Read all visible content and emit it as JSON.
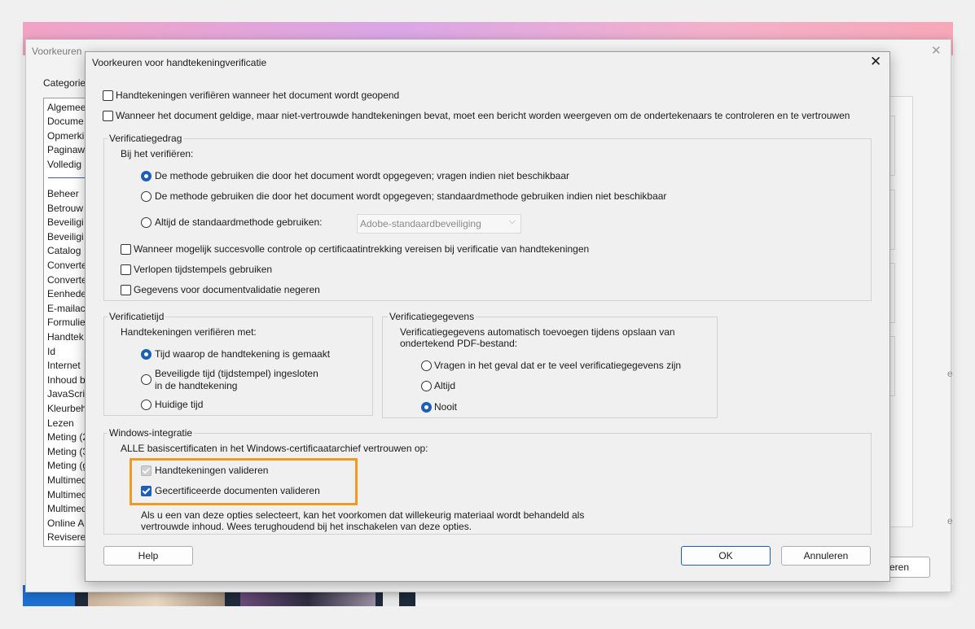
{
  "background_window": {
    "title": "Voorkeuren",
    "categories_label": "Categorie",
    "categories_top": [
      "Algemee",
      "Docume",
      "Opmerki",
      "Paginaw",
      "Volledig"
    ],
    "categories": [
      "Beheer",
      "Betrouw",
      "Beveiligi",
      "Beveiligi",
      "Catalog",
      "Converte",
      "Converte",
      "Eenhede",
      "E-mailac",
      "Formulie",
      "Handtek",
      "Id",
      "Internet",
      "Inhoud b",
      "JavaScri",
      "Kleurbeh",
      "Lezen",
      "Meting (2",
      "Meting (3",
      "Meting (g",
      "Multimed",
      "Multimec",
      "Multimed",
      "Online A",
      "Reviseren"
    ],
    "button_label_partial": "eren",
    "edge_letter": "e"
  },
  "dialog": {
    "title": "Voorkeuren voor handtekeningverificatie",
    "top_options": [
      {
        "label": "Handtekeningen verifiëren wanneer het document wordt geopend",
        "checked": false
      },
      {
        "label": "Wanneer het document geldige, maar niet-vertrouwde handtekeningen bevat, moet een bericht worden weergeven om de ondertekenaars te controleren en te vertrouwen",
        "checked": false
      }
    ],
    "verification_behavior": {
      "legend": "Verificatiegedrag",
      "subtitle": "Bij het verifiëren:",
      "radios": [
        {
          "label": "De methode gebruiken die door het document wordt opgegeven; vragen indien niet beschikbaar",
          "checked": true
        },
        {
          "label": "De methode gebruiken die door het document wordt opgegeven; standaardmethode gebruiken indien niet beschikbaar",
          "checked": false
        },
        {
          "label": "Altijd de standaardmethode gebruiken:",
          "checked": false
        }
      ],
      "dropdown_value": "Adobe-standaardbeveiliging",
      "checkboxes": [
        {
          "label": "Wanneer mogelijk succesvolle controle op certificaatintrekking vereisen bij verificatie van handtekeningen",
          "checked": false
        },
        {
          "label": "Verlopen tijdstempels gebruiken",
          "checked": false
        },
        {
          "label": "Gegevens voor documentvalidatie negeren",
          "checked": false
        }
      ]
    },
    "verification_time": {
      "legend": "Verificatietijd",
      "subtitle": "Handtekeningen verifiëren met:",
      "radios": [
        {
          "label": "Tijd waarop de handtekening is gemaakt",
          "checked": true
        },
        {
          "label_line1": "Beveiligde tijd (tijdstempel) ingesloten",
          "label_line2": "in de handtekening",
          "checked": false
        },
        {
          "label": "Huidige tijd",
          "checked": false
        }
      ]
    },
    "verification_data": {
      "legend": "Verificatiegegevens",
      "subtitle_line1": "Verificatiegegevens automatisch toevoegen tijdens opslaan van",
      "subtitle_line2": "ondertekend PDF-bestand:",
      "radios": [
        {
          "label": "Vragen in het geval dat er te veel verificatiegegevens zijn",
          "checked": false
        },
        {
          "label": "Altijd",
          "checked": false
        },
        {
          "label": "Nooit",
          "checked": true
        }
      ]
    },
    "windows_integration": {
      "legend": "Windows-integratie",
      "subtitle": "ALLE basiscertificaten in het Windows-certificaatarchief vertrouwen op:",
      "checkboxes": [
        {
          "label": "Handtekeningen valideren",
          "checked": true,
          "disabled": true
        },
        {
          "label": "Gecertificeerde documenten valideren",
          "checked": true,
          "disabled": false
        }
      ],
      "note_line1": "Als u een van deze opties selecteert, kan het voorkomen dat willekeurig materiaal wordt behandeld als",
      "note_line2": "vertrouwde inhoud. Wees terughoudend bij het inschakelen van deze opties."
    },
    "buttons": {
      "help": "Help",
      "ok": "OK",
      "cancel": "Annuleren"
    }
  },
  "colors": {
    "accent": "#1c5fb8",
    "highlight": "#f29a1f"
  }
}
